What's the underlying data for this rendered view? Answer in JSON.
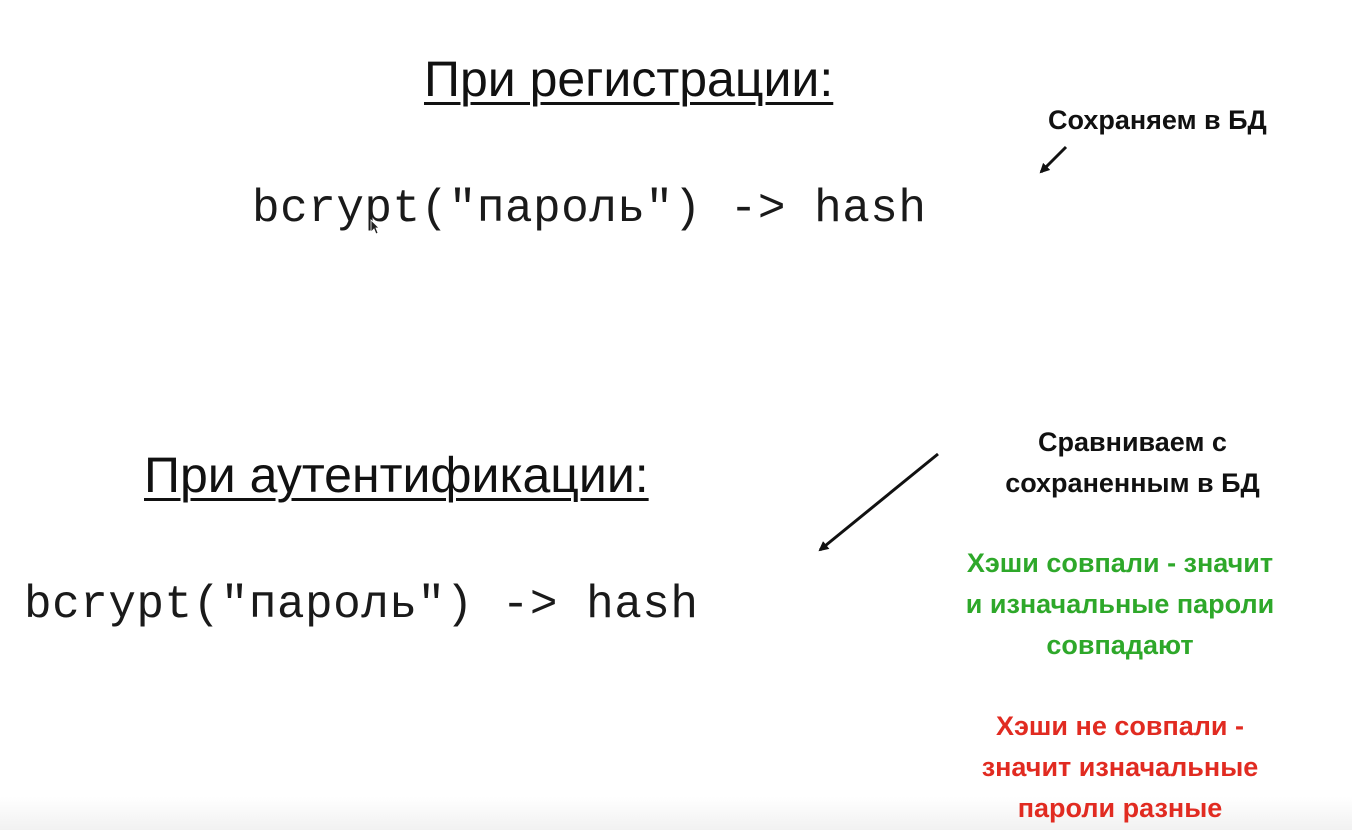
{
  "registration": {
    "heading": "При регистрации:",
    "code": "bcrypt(\"пароль\") -> hash",
    "note": "Сохраняем в БД"
  },
  "authentication": {
    "heading": "При аутентификации:",
    "code": "bcrypt(\"пароль\") -> hash",
    "compare_note": [
      "Сравниваем с",
      "сохраненным в БД"
    ],
    "match_note": [
      "Хэши совпали - значит",
      "и изначальные пароли",
      "совпадают"
    ],
    "mismatch_note": [
      "Хэши не совпали -",
      "значит изначальные",
      "пароли разные"
    ]
  },
  "colors": {
    "match": "#2ea82a",
    "mismatch": "#e12b21",
    "text": "#111111"
  },
  "icons": {
    "arrow": "arrow-down-left-icon",
    "cursor": "mouse-cursor-icon"
  }
}
